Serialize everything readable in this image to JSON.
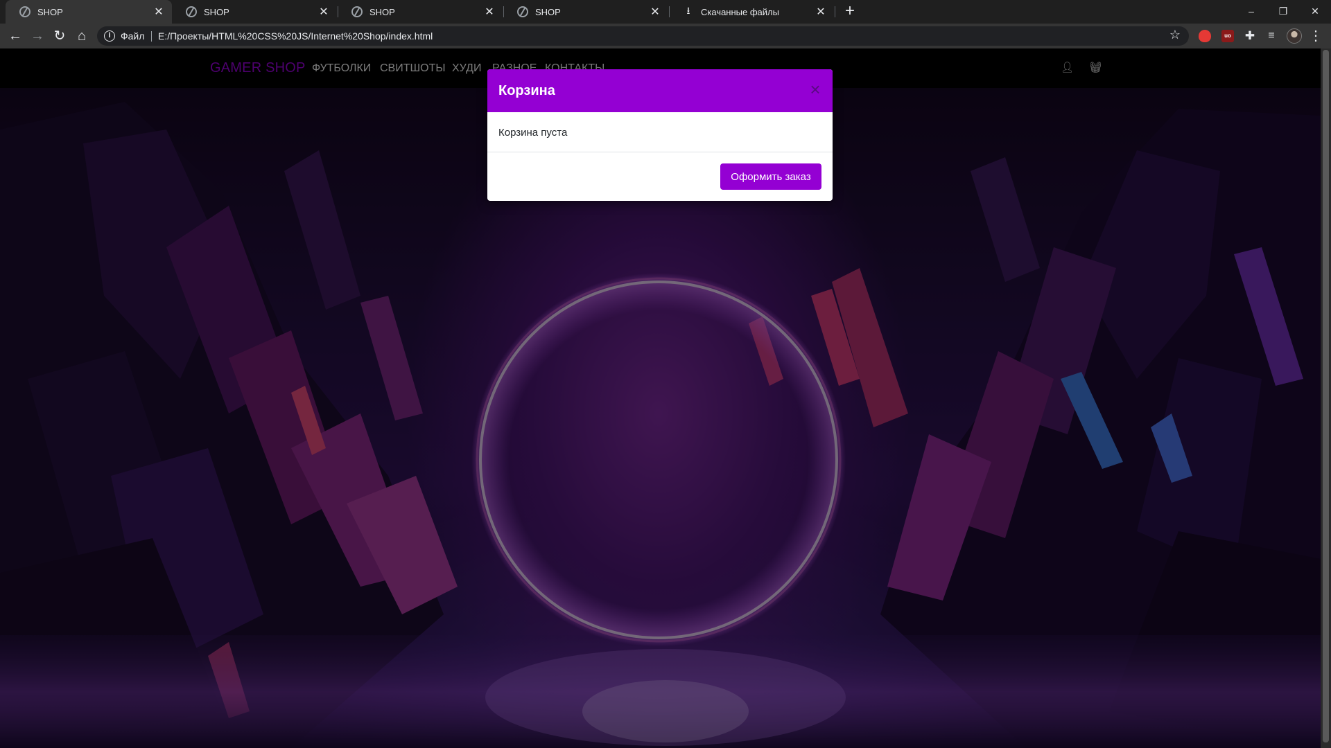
{
  "browser": {
    "tabs": [
      {
        "title": "SHOP",
        "close": "✕"
      },
      {
        "title": "SHOP",
        "close": "✕"
      },
      {
        "title": "SHOP",
        "close": "✕"
      },
      {
        "title": "SHOP",
        "close": "✕"
      },
      {
        "title": "Скачанные файлы",
        "close": "✕"
      }
    ],
    "new_tab": "+",
    "window_controls": {
      "minimize": "–",
      "restore": "❐",
      "close": "✕"
    },
    "address_bar": {
      "scheme_label": "Файл",
      "url": "E:/Проекты/HTML%20CSS%20JS/Internet%20Shop/index.html"
    },
    "extensions": {
      "ublock_badge": "uo"
    }
  },
  "site": {
    "brand": "GAMER SHOP",
    "nav": [
      "ФУТБОЛКИ",
      "СВИТШОТЫ",
      "ХУДИ",
      "РАЗНОЕ",
      "КОНТАКТЫ"
    ]
  },
  "cart_modal": {
    "title": "Корзина",
    "empty_message": "Корзина пуста",
    "checkout_label": "Оформить заказ",
    "close_symbol": "×"
  },
  "colors": {
    "accent": "#9400d3",
    "navbar": "#000000",
    "browser_tabstrip": "#1f1f1f",
    "browser_toolbar": "#353535"
  }
}
